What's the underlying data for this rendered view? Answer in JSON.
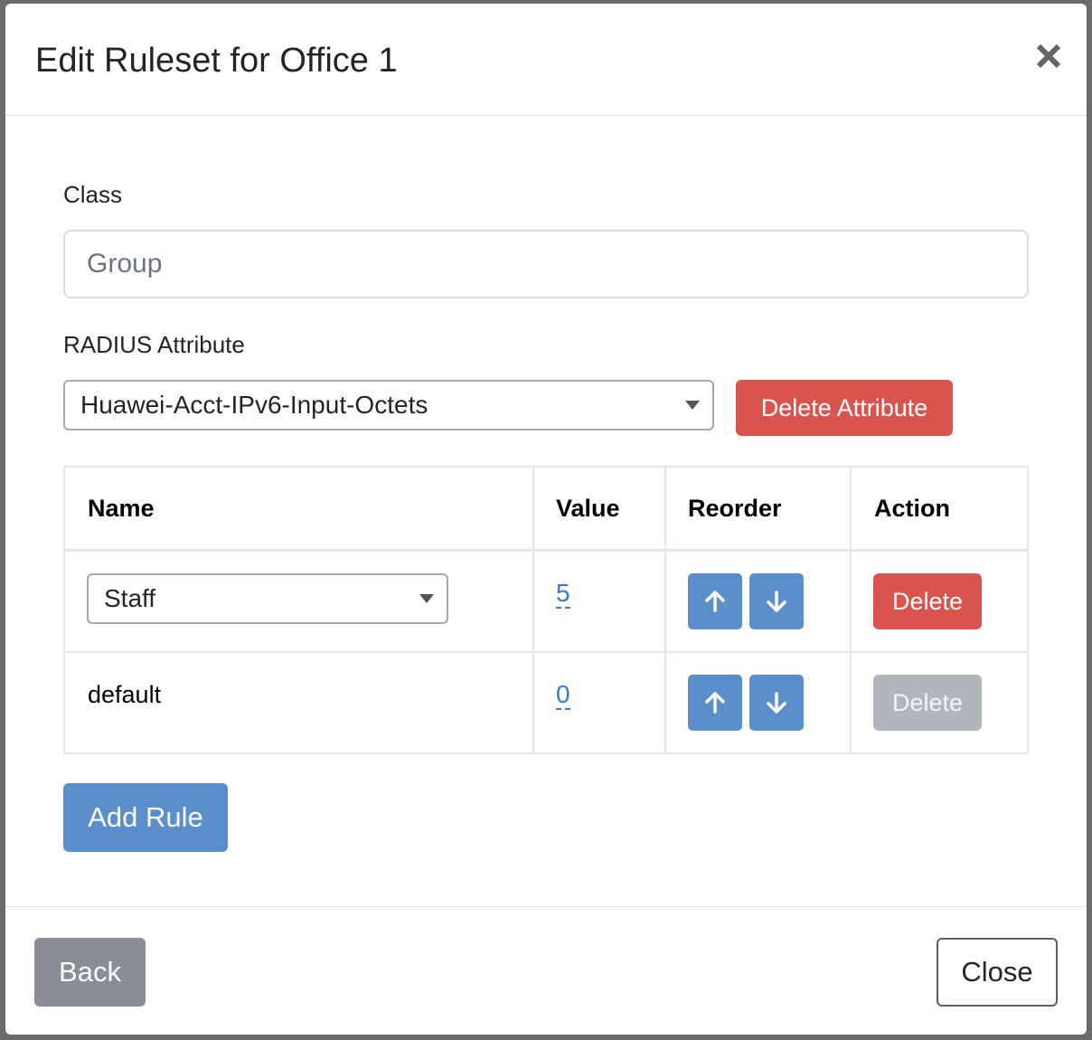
{
  "modal": {
    "title": "Edit Ruleset for Office 1"
  },
  "form": {
    "class_label": "Class",
    "class_placeholder": "Group",
    "class_value": "",
    "attribute_label": "RADIUS Attribute",
    "attribute_selected": "Huawei-Acct-IPv6-Input-Octets",
    "delete_attribute_label": "Delete Attribute"
  },
  "table": {
    "headers": {
      "name": "Name",
      "value": "Value",
      "reorder": "Reorder",
      "action": "Action"
    },
    "rows": [
      {
        "name": "Staff",
        "name_is_select": true,
        "value": "5",
        "action": "Delete",
        "action_enabled": true
      },
      {
        "name": "default",
        "name_is_select": false,
        "value": "0",
        "action": "Delete",
        "action_enabled": false
      }
    ]
  },
  "add_rule_label": "Add Rule",
  "footer": {
    "back_label": "Back",
    "close_label": "Close"
  },
  "icons": {
    "close": "close-icon",
    "up": "arrow-up-icon",
    "down": "arrow-down-icon",
    "caret": "chevron-down-icon"
  },
  "colors": {
    "primary": "#5a8fcc",
    "danger": "#d9534f",
    "disabled": "#b3b5bd",
    "secondary": "#8a8d98",
    "link": "#3a7bc8"
  }
}
